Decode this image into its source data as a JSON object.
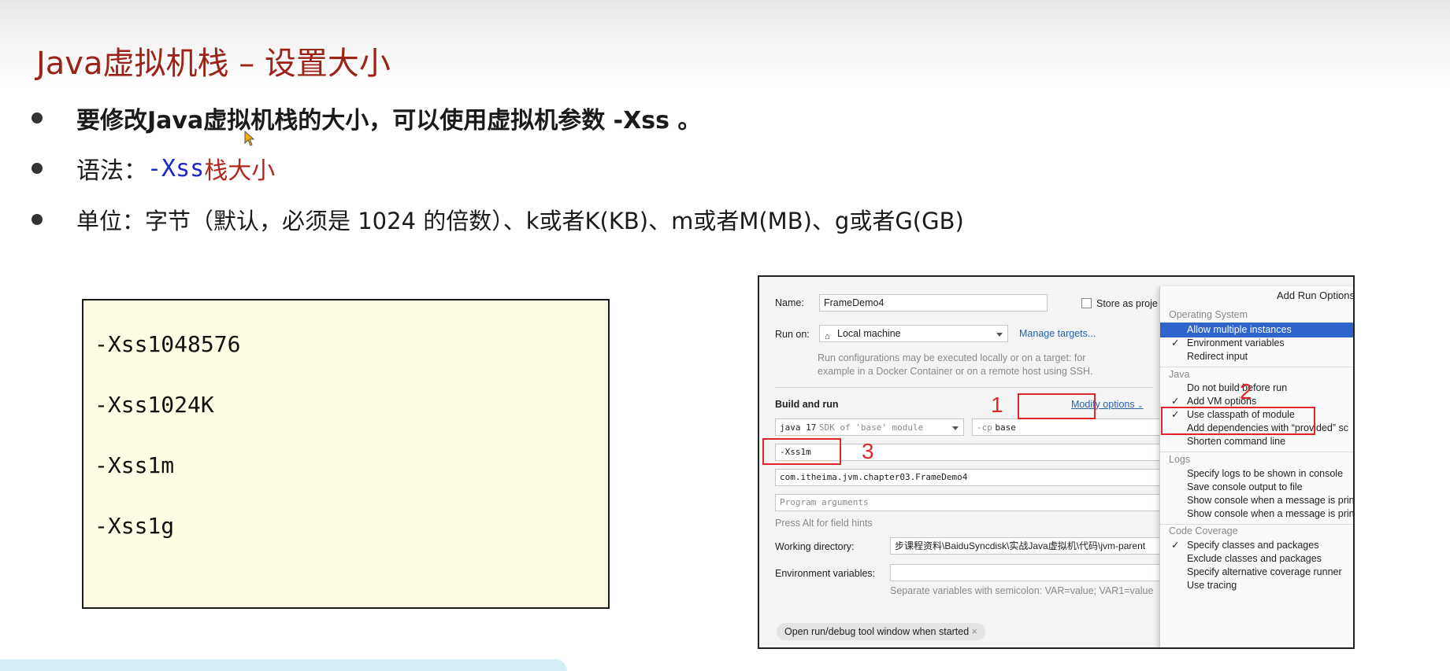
{
  "slide": {
    "title": "Java虚拟机栈 – 设置大小",
    "bullet1": "要修改Java虚拟机栈的大小，可以使用虚拟机参数 -Xss 。",
    "bullet2_prefix": "语法：",
    "bullet2_flag": "-Xss",
    "bullet2_suffix": "栈大小",
    "bullet3": "单位：字节（默认，必须是 1024 的倍数）、k或者K(KB)、m或者M(MB)、g或者G(GB)",
    "code_lines": [
      "-Xss1048576",
      "-Xss1024K",
      "-Xss1m",
      "-Xss1g"
    ]
  },
  "ide": {
    "name_label": "Name:",
    "name_value": "FrameDemo4",
    "store_label": "Store as proje",
    "run_on_label": "Run on:",
    "run_on_value": "Local machine",
    "manage_targets": "Manage targets...",
    "run_hint_line1": "Run configurations may be executed locally or on a target: for",
    "run_hint_line2": "example in a Docker Container or on a remote host using SSH.",
    "build_and_run": "Build and run",
    "modify_options": "Modify options",
    "sdk_value": "java 17",
    "sdk_hint": "SDK of 'base' module",
    "cp_label": "-cp",
    "cp_value": "base",
    "vm_options_value": "-Xss1m",
    "main_class_value": "com.itheima.jvm.chapter03.FrameDemo4",
    "program_args_placeholder": "Program arguments",
    "alt_hint": "Press Alt for field hints",
    "working_dir_label": "Working directory:",
    "working_dir_value": "步课程资料\\BaiduSyncdisk\\实战Java虚拟机\\代码\\jvm-parent",
    "env_vars_label": "Environment variables:",
    "env_hint": "Separate variables with semicolon: VAR=value; VAR1=value",
    "open_tool_window": "Open run/debug tool window when started",
    "markers": [
      "1",
      "2",
      "3"
    ]
  },
  "popup": {
    "header": "Add Run Options",
    "sections": [
      {
        "title": "Operating System",
        "items": [
          {
            "label": "Allow multiple instances",
            "checked": false,
            "selected": true
          },
          {
            "label": "Environment variables",
            "checked": true,
            "selected": false
          },
          {
            "label": "Redirect input",
            "checked": false,
            "selected": false
          }
        ]
      },
      {
        "title": "Java",
        "items": [
          {
            "label": "Do not build before run",
            "checked": false,
            "selected": false
          },
          {
            "label": "Add VM options",
            "checked": true,
            "selected": false
          },
          {
            "label": "Use classpath of module",
            "checked": true,
            "selected": false
          },
          {
            "label": "Add dependencies with “provided” sc",
            "checked": false,
            "selected": false
          },
          {
            "label": "Shorten command line",
            "checked": false,
            "selected": false
          }
        ]
      },
      {
        "title": "Logs",
        "items": [
          {
            "label": "Specify logs to be shown in console",
            "checked": false,
            "selected": false
          },
          {
            "label": "Save console output to file",
            "checked": false,
            "selected": false
          },
          {
            "label": "Show console when a message is prin",
            "checked": false,
            "selected": false
          },
          {
            "label": "Show console when a message is prin",
            "checked": false,
            "selected": false
          }
        ]
      },
      {
        "title": "Code Coverage",
        "items": [
          {
            "label": "Specify classes and packages",
            "checked": true,
            "selected": false
          },
          {
            "label": "Exclude classes and packages",
            "checked": false,
            "selected": false
          },
          {
            "label": "Specify alternative coverage runner",
            "checked": false,
            "selected": false
          },
          {
            "label": "Use tracing",
            "checked": false,
            "selected": false
          }
        ]
      }
    ]
  },
  "colors": {
    "title_red": "#9b2318",
    "flag_blue": "#1a27c9",
    "code_bg": "#fefce4",
    "highlight_red": "#e0262b",
    "selection_blue": "#2f65ca"
  }
}
